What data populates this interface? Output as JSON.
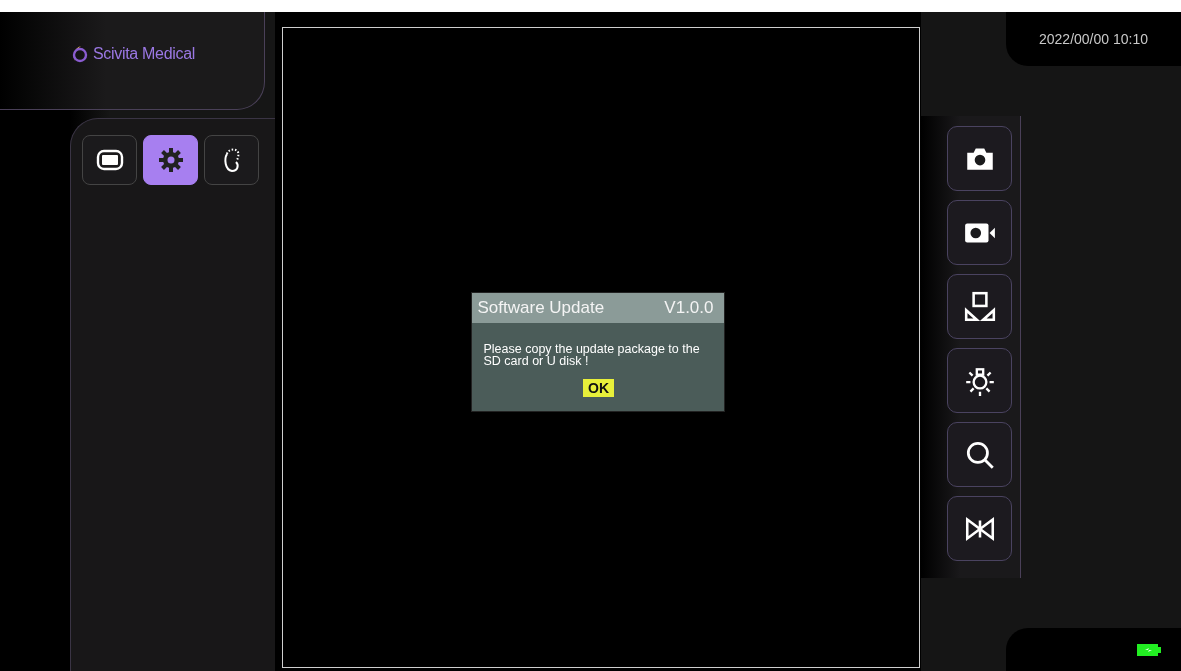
{
  "logo": {
    "text": "Scivita Medical"
  },
  "tabs": [
    {
      "kind": "display",
      "selected": false
    },
    {
      "kind": "settings",
      "selected": true
    },
    {
      "kind": "scope",
      "selected": false
    }
  ],
  "datetime": "2022/00/00 10:10",
  "tools": [
    {
      "kind": "camera"
    },
    {
      "kind": "video"
    },
    {
      "kind": "layout"
    },
    {
      "kind": "light"
    },
    {
      "kind": "zoom"
    },
    {
      "kind": "freeze"
    }
  ],
  "dialog": {
    "title": "Software Update",
    "version": "V1.0.0",
    "message": "Please copy the update package to the SD card or U disk !",
    "button": "OK"
  },
  "battery": {
    "charging": true
  }
}
